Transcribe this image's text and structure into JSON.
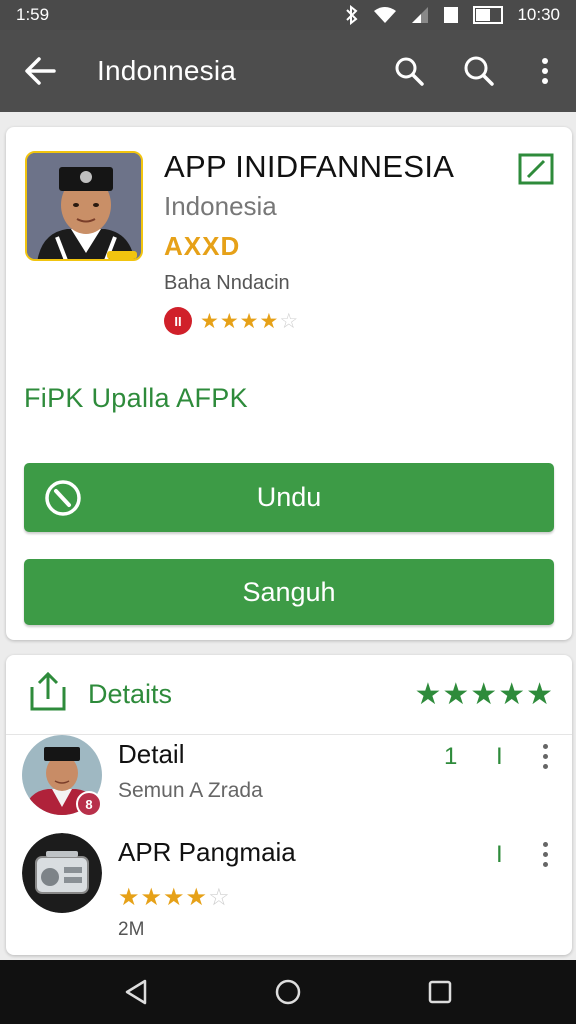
{
  "status_bar": {
    "time": "1:59",
    "clock_right": "10:30",
    "icons": [
      "bluetooth-icon",
      "wifi-icon",
      "signal-icon",
      "battery-icon"
    ]
  },
  "app_bar": {
    "title": "Indonnesia",
    "icons": [
      "back-arrow-icon",
      "search-icon",
      "search-icon",
      "more-vert-icon"
    ]
  },
  "app": {
    "name": "APP INIDFANNESIA",
    "developer": "Indonesia",
    "badge": "AXXD",
    "sub_name": "Baha Nndacin",
    "rating_badge": "II",
    "rating_stars": 4,
    "rating_max": 5,
    "promo": "FiPK Upalla AFPK",
    "install_label": "Undu",
    "second_label": "Sanguh"
  },
  "details": {
    "title": "Detaits",
    "stars": 5,
    "items": [
      {
        "title": "Detail",
        "subtitle": "Semun A Zrada",
        "count_1": "1",
        "count_2": "I",
        "avatar_badge": "8"
      },
      {
        "title": "APR Pangmaia",
        "count_2": "I",
        "rating_stars": 4,
        "rating_max": 5,
        "size": "2M"
      }
    ]
  },
  "colors": {
    "accent_green": "#3d9b46",
    "text_green": "#2e8b3b",
    "star_gold": "#e6a118",
    "app_bar": "#4d4d4d",
    "nav_bar": "#111111"
  },
  "nav_bar": {
    "icons": [
      "back-triangle-icon",
      "home-circle-icon",
      "recents-square-icon"
    ]
  }
}
